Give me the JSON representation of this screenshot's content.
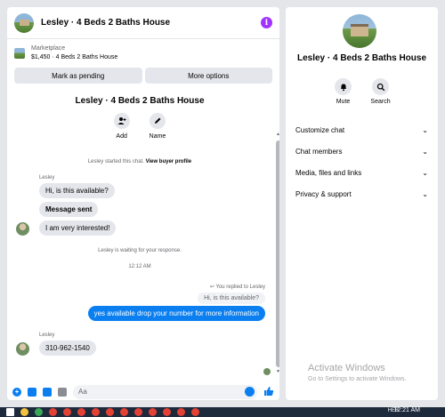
{
  "chat": {
    "title": "Lesley · 4 Beds 2 Baths House",
    "listing_category": "Marketplace",
    "listing_price": "$1,450 · 4 Beds 2 Baths House",
    "mark_pending": "Mark as pending",
    "more_options": "More options",
    "thread_title": "Lesley · 4 Beds 2 Baths House",
    "add_label": "Add",
    "name_label": "Name",
    "started_text": "Lesley started this chat.",
    "view_profile": "View buyer profile",
    "sender_name": "Lesley",
    "msg1": "Hi, is this available?",
    "msg2": "Message sent",
    "msg3": "I am very interested!",
    "waiting": "Lesley is waiting for your response.",
    "timestamp": "12:12 AM",
    "replied_to": "You replied to Lesley",
    "quoted": "Hi, is this available?",
    "reply": "yes available drop your number for more information",
    "sender_name_2": "Lesley",
    "phone": "310-962-1540",
    "composer_placeholder": "Aa"
  },
  "info": {
    "title": "Lesley · 4 Beds 2 Baths House",
    "mute_label": "Mute",
    "search_label": "Search",
    "menu": [
      {
        "label": "Customize chat"
      },
      {
        "label": "Chat members"
      },
      {
        "label": "Media, files and links"
      },
      {
        "label": "Privacy & support"
      }
    ]
  },
  "watermark": {
    "title": "Activate Windows",
    "subtitle": "Go to Settings to activate Windows."
  },
  "taskbar": {
    "time": "12:21 AM",
    "weather": "HEB"
  },
  "colors": {
    "accent": "#0b7ff0",
    "info_purple": "#a033ff"
  }
}
